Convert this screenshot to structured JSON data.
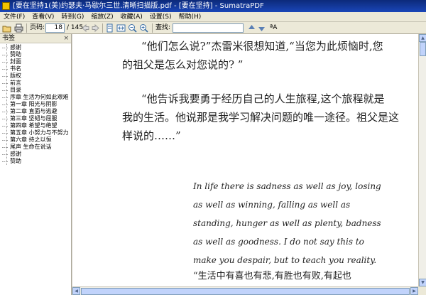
{
  "window": {
    "title": "[要在坚持1(美)约瑟夫·马歇尔三世.清晰扫描版.pdf - [要在坚持] - SumatraPDF"
  },
  "menu": [
    "文件(F)",
    "查看(V)",
    "转到(G)",
    "缩放(Z)",
    "收藏(A)",
    "设置(S)",
    "帮助(H)"
  ],
  "toolbar": {
    "page_label": "页码:",
    "page_value": "18",
    "page_total": "/ 145",
    "find_label": "查找:",
    "find_value": "",
    "case_label": "ªA"
  },
  "sidebar": {
    "title": "书签",
    "close": "×",
    "items": [
      "感谢",
      "赞助",
      "封面",
      "书名",
      "版权",
      "前言",
      "目录",
      "序章 生活为何如此艰难",
      "第一章 阳光与阴影",
      "第二章 直面与逃避",
      "第三章 坚韧与屈服",
      "第四章 希望与绝望",
      "第五章 小努力与不努力",
      "第六章 持之以恒",
      "尾声 生命在说话",
      "感谢",
      "赞助"
    ]
  },
  "document": {
    "lines_cn": [
      "“他们怎么说?”杰雷米很想知道,“当您为此烦恼时,您",
      "的祖父是怎么对您说的? ”",
      "“他告诉我要勇于经历自己的人生旅程,这个旅程就是",
      "我的生活。他说那是我学习解决问题的唯一途径。祖父是这",
      "样说的……”"
    ],
    "lines_en": [
      "In life there is sadness as well as joy, losing",
      "as well as winning, falling as well as",
      "standing, hunger as well as plenty, badness",
      "as well as goodness. I do not say this to",
      "make you despair, but to teach you reality."
    ],
    "last_cn": "“生活中有喜也有悲,有胜也有败,有起也"
  }
}
